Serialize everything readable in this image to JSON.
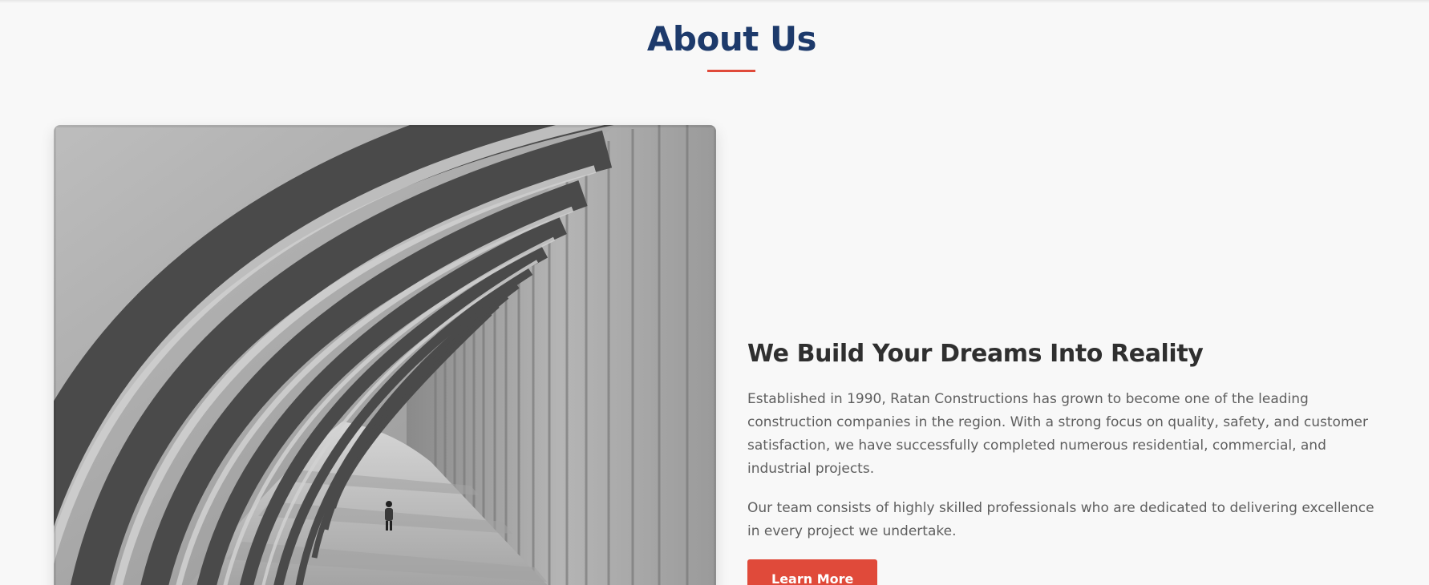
{
  "about": {
    "title": "About Us",
    "heading": "We Build Your Dreams Into Reality",
    "paragraphs": [
      "Established in 1990, Ratan Constructions has grown to become one of the leading construction companies in the region. With a strong focus on quality, safety, and customer satisfaction, we have successfully completed numerous residential, commercial, and industrial projects.",
      "Our team consists of highly skilled professionals who are dedicated to delivering excellence in every project we undertake."
    ],
    "button_label": "Learn More"
  },
  "colors": {
    "title": "#1d3a6b",
    "accent": "#e04a3a",
    "heading": "#2f2f2f",
    "body_text": "#5e5e5e",
    "background": "#f8f8f8"
  }
}
